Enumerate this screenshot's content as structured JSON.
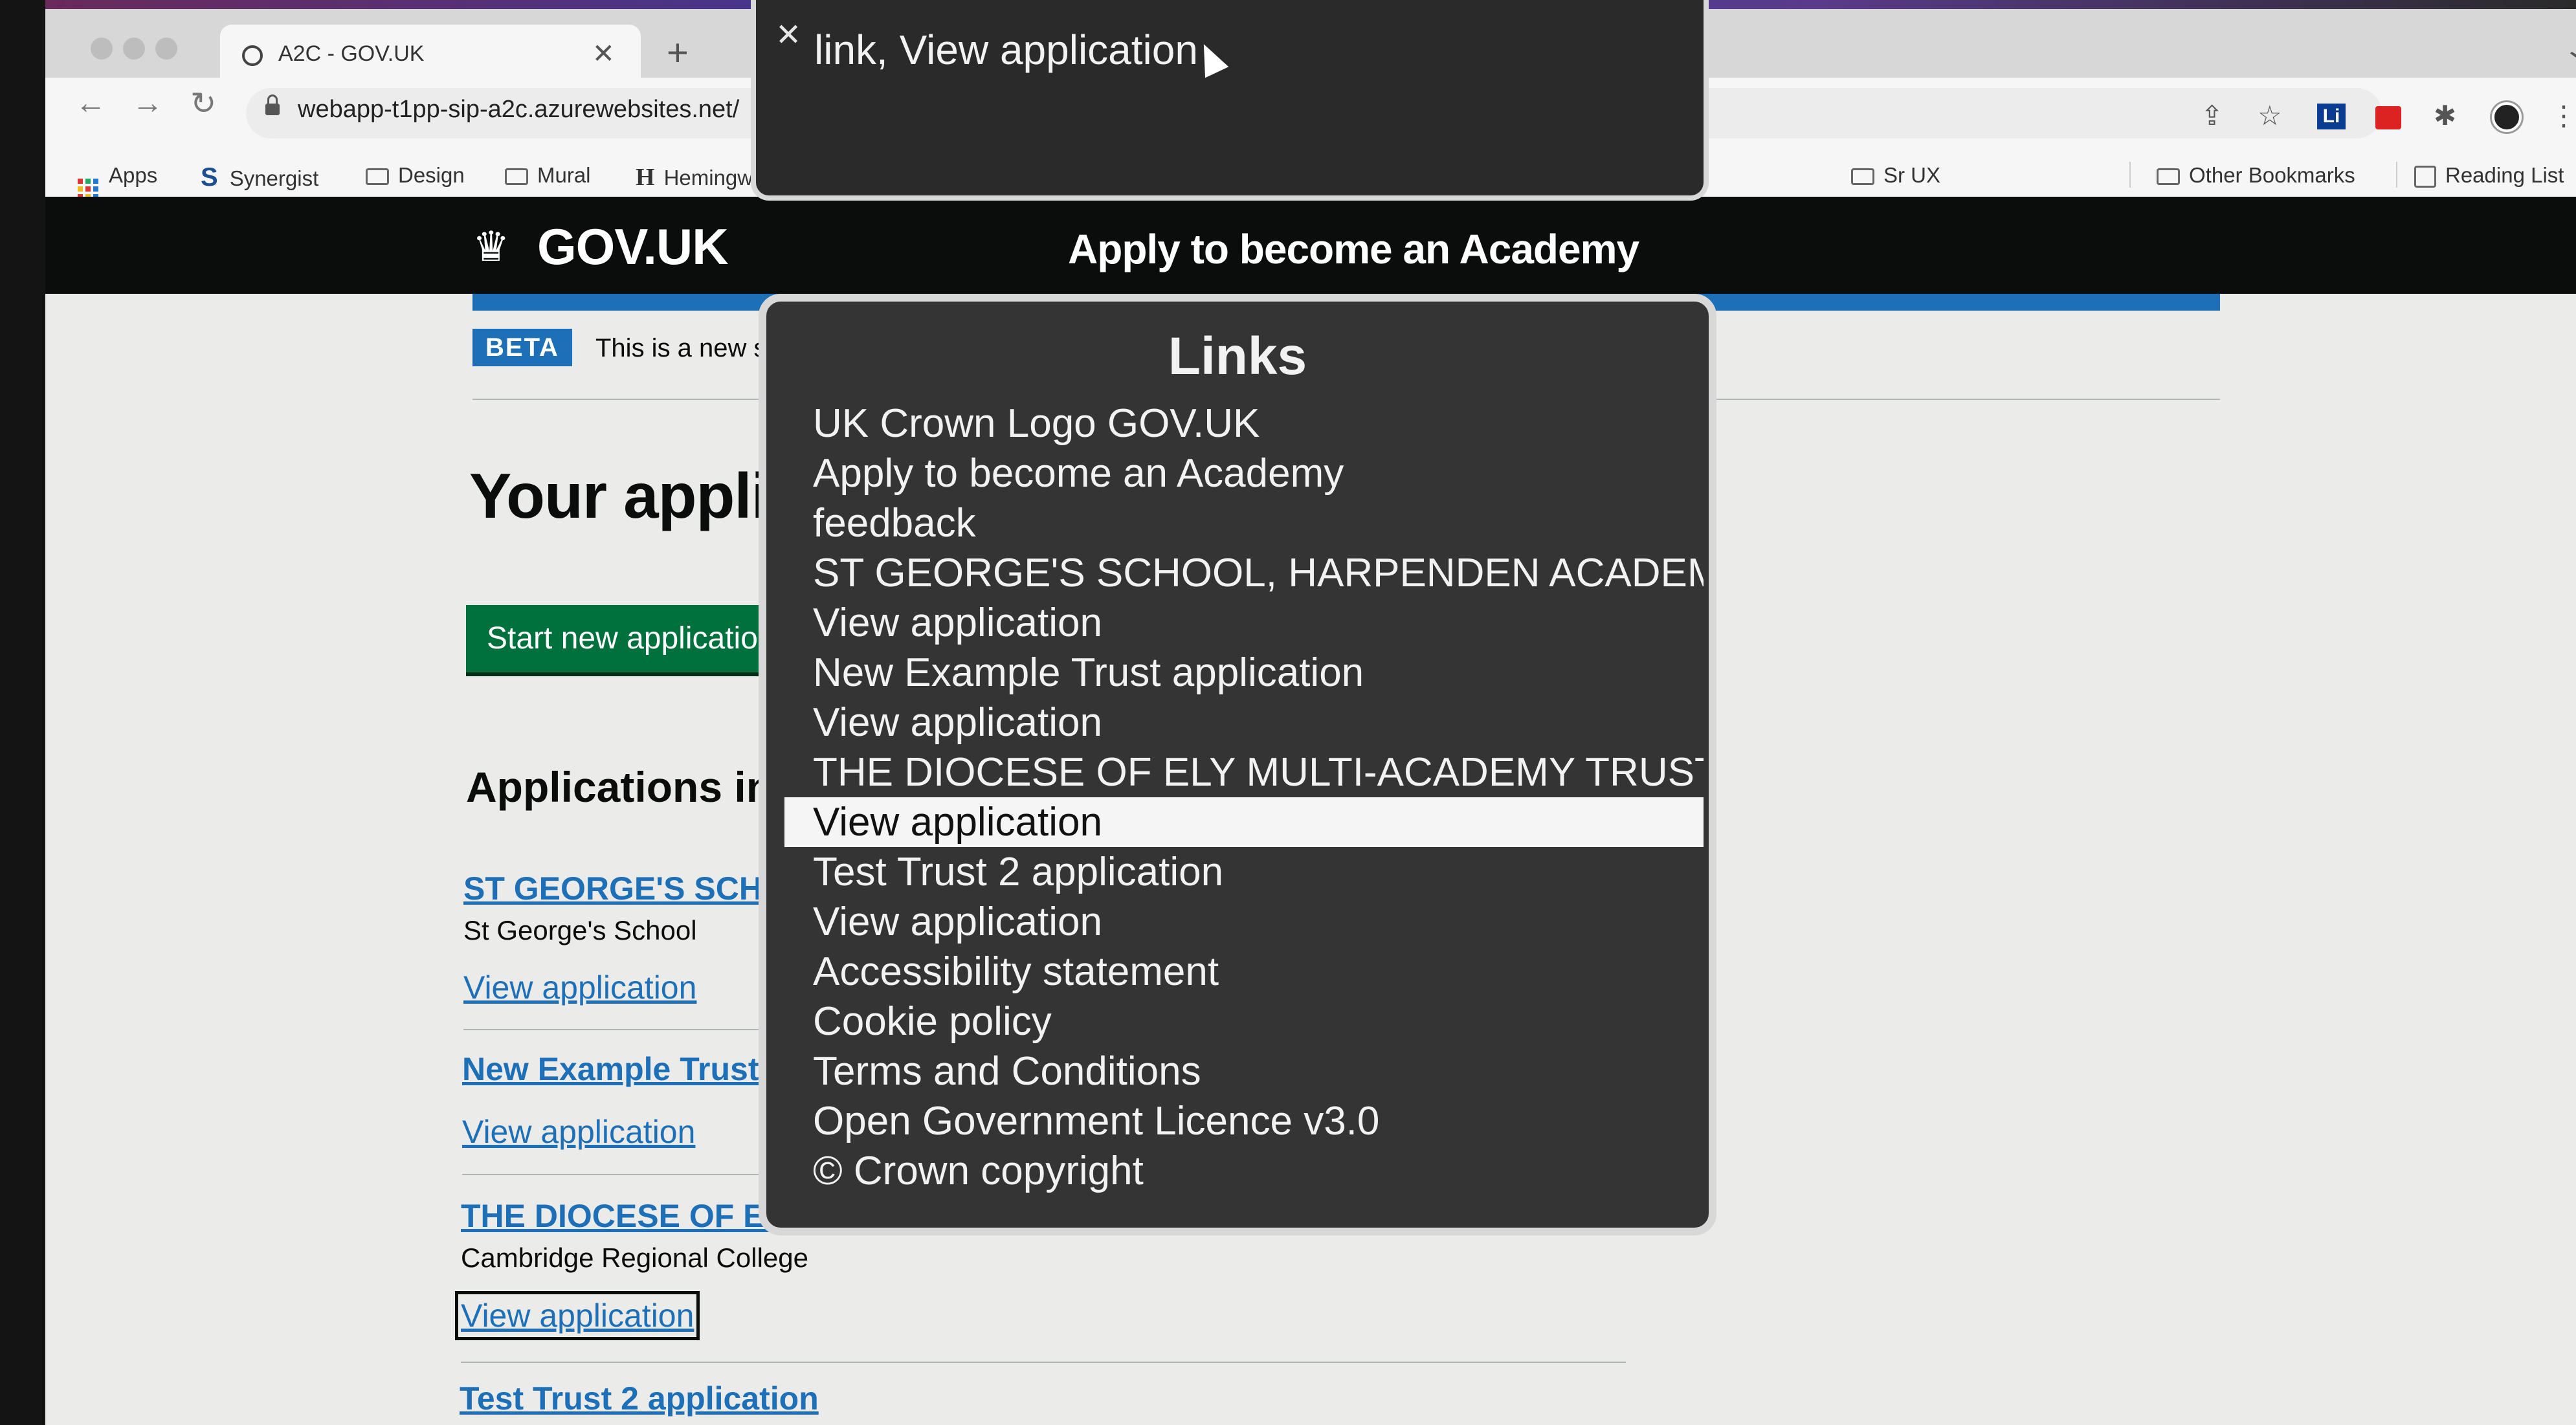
{
  "browser": {
    "tab_title": "A2C - GOV.UK",
    "url": "webapp-t1pp-sip-a2c.azurewebsites.net/",
    "bookmarks": [
      "Apps",
      "Synergist",
      "Design",
      "Mural",
      "Hemingway",
      "Sr UX",
      "Other Bookmarks",
      "Reading List"
    ],
    "bookmark_icons": {
      "synergist": "S",
      "hemingway": "H"
    }
  },
  "govuk": {
    "logo": "GOV.UK",
    "service_name": "Apply to become an Academy",
    "phase_tag": "BETA",
    "phase_text": "This is a new serv",
    "heading": "Your applica",
    "start_button": "Start new application",
    "section_heading": "Applications in pr",
    "applications": [
      {
        "title": "ST GEORGE'S SCHOO",
        "subtitle": "St George's School",
        "view": "View application"
      },
      {
        "title": "New Example Trust ap",
        "subtitle": "",
        "view": "View application"
      },
      {
        "title": "THE DIOCESE OF ELY",
        "subtitle": "Cambridge Regional College",
        "view": "View application"
      },
      {
        "title": "Test Trust 2 application",
        "subtitle": "",
        "view": ""
      }
    ]
  },
  "voiceover": {
    "caption": "link, View application",
    "rotor_title": "Links",
    "links": [
      "UK Crown Logo GOV.UK",
      "Apply to become an Academy",
      "feedback",
      "ST GEORGE'S SCHOOL, HARPENDEN ACADEMY…",
      "View application",
      "New Example Trust application",
      "View application",
      "THE DIOCESE OF ELY MULTI-ACADEMY TRUST a…",
      "View application",
      "Test Trust 2 application",
      "View application",
      "Accessibility statement",
      "Cookie policy",
      "Terms and Conditions",
      "Open Government Licence v3.0",
      "© Crown copyright"
    ],
    "selected_index": 8
  },
  "colors": {
    "govuk_black": "#0b0c0c",
    "govuk_blue": "#1d70b8",
    "govuk_green": "#00703c"
  }
}
